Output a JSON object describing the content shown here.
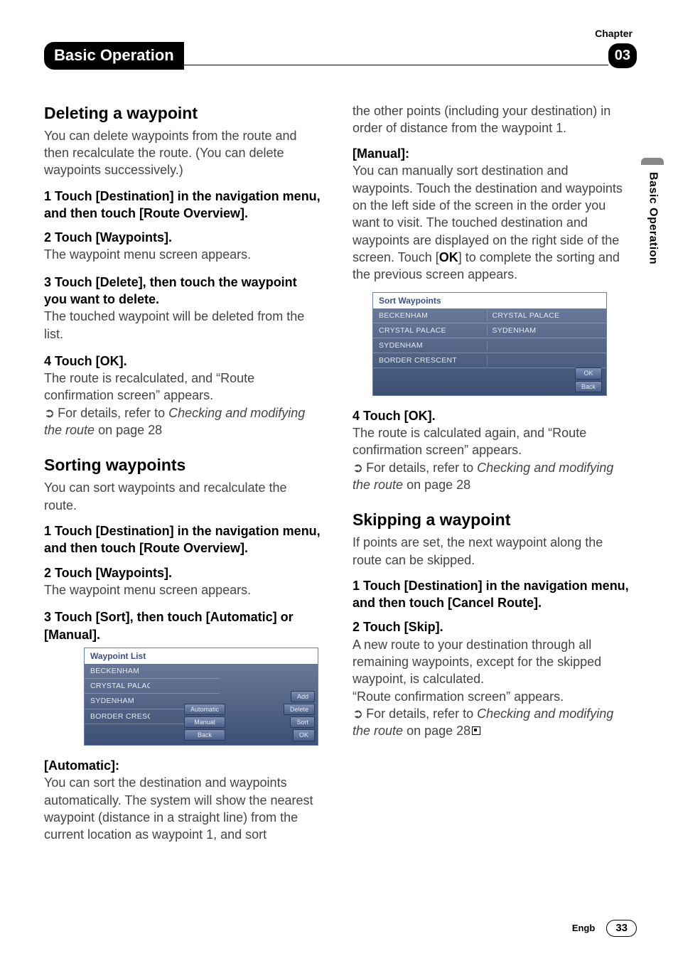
{
  "chapter_label": "Chapter",
  "chapter_number": "03",
  "header_title": "Basic Operation",
  "side_tab": "Basic Operation",
  "footer": {
    "lang": "Engb",
    "page": "33"
  },
  "left": {
    "h_delete": "Deleting a waypoint",
    "delete_intro": "You can delete waypoints from the route and then recalculate the route. (You can delete waypoints successively.)",
    "d1": "1    Touch [Destination] in the navigation menu, and then touch [Route Overview].",
    "d2": "2    Touch [Waypoints].",
    "d2b": "The waypoint menu screen appears.",
    "d3": "3    Touch [Delete], then touch the waypoint you want to delete.",
    "d3b": "The touched waypoint will be deleted from the list.",
    "d4": "4    Touch [OK].",
    "d4b": "The route is recalculated, and “Route confirmation screen” appears.",
    "d_ref_a": "For details, refer to ",
    "d_ref_b": "Checking and modifying the route",
    "d_ref_c": " on page 28",
    "h_sort": "Sorting waypoints",
    "sort_intro": "You can sort waypoints and recalculate the route.",
    "s1": "1    Touch [Destination] in the navigation menu, and then touch [Route Overview].",
    "s2": "2    Touch [Waypoints].",
    "s2b": "The waypoint menu screen appears.",
    "s3": "3    Touch [Sort], then touch [Automatic] or [Manual].",
    "shot1": {
      "title": "Waypoint List",
      "rows": [
        "BECKENHAM",
        "CRYSTAL PALACE",
        "SYDENHAM",
        "BORDER CRESCENT"
      ],
      "btns_right": [
        "Add",
        "Delete",
        "Sort",
        "OK"
      ],
      "btns_mid": [
        "Automatic",
        "Manual",
        "Back"
      ]
    },
    "auto_label": "[Automatic]:",
    "auto_body": "You can sort the destination and waypoints automatically. The system will show the nearest waypoint (distance in a straight line) from the current location as waypoint 1, and sort"
  },
  "right": {
    "cont1": "the other points (including your destination) in order of distance from the waypoint 1.",
    "manual_label": "[Manual]:",
    "manual_body_a": "You can manually sort destination and waypoints. Touch the destination and waypoints on the left side of the screen in the order you want to visit. The touched destination and waypoints are displayed on the right side of the screen. Touch [",
    "manual_body_ok": "OK",
    "manual_body_b": "] to complete the sorting and the previous screen appears.",
    "shot2": {
      "title": "Sort Waypoints",
      "left_rows": [
        "BECKENHAM",
        "CRYSTAL PALACE",
        "SYDENHAM",
        "BORDER CRESCENT"
      ],
      "right_rows": [
        "CRYSTAL PALACE",
        "SYDENHAM",
        "",
        ""
      ],
      "btns": [
        "OK",
        "Back"
      ]
    },
    "r4": "4    Touch [OK].",
    "r4b": "The route is calculated again, and “Route confirmation screen” appears.",
    "r_ref_a": "For details, refer to ",
    "r_ref_b": "Checking and modifying the route",
    "r_ref_c": " on page 28",
    "h_skip": "Skipping a waypoint",
    "skip_intro": "If points are set, the next waypoint along the route can be skipped.",
    "sk1": "1    Touch [Destination] in the navigation menu, and then touch [Cancel Route].",
    "sk2": "2    Touch [Skip].",
    "sk2b": "A new route to your destination through all remaining waypoints, except for the skipped waypoint, is calculated.",
    "sk2c": "“Route confirmation screen” appears.",
    "sk_ref_a": "For details, refer to ",
    "sk_ref_b": "Checking and modifying the route",
    "sk_ref_c": " on page 28"
  }
}
